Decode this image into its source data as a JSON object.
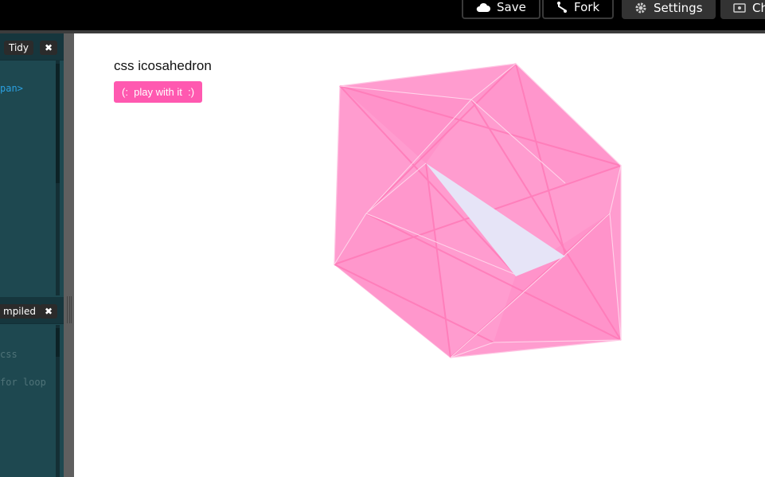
{
  "toolbar": {
    "save_label": "Save",
    "fork_label": "Fork",
    "settings_label": "Settings",
    "change_view_label": "Ch"
  },
  "editor_top": {
    "tidy_label": "Tidy",
    "close_glyph": "✖",
    "code_lines": [
      "pan>"
    ]
  },
  "editor_bottom": {
    "compiled_label": "mpiled",
    "close_glyph": "✖",
    "code_lines": [
      "css",
      "for loop"
    ]
  },
  "preview": {
    "title": "css icosahedron",
    "button_label": "(:  play with it  :)",
    "accent_color": "#ff59b0",
    "face_color": "#ff9ccf",
    "highlight_color": "#e6e4f7"
  }
}
